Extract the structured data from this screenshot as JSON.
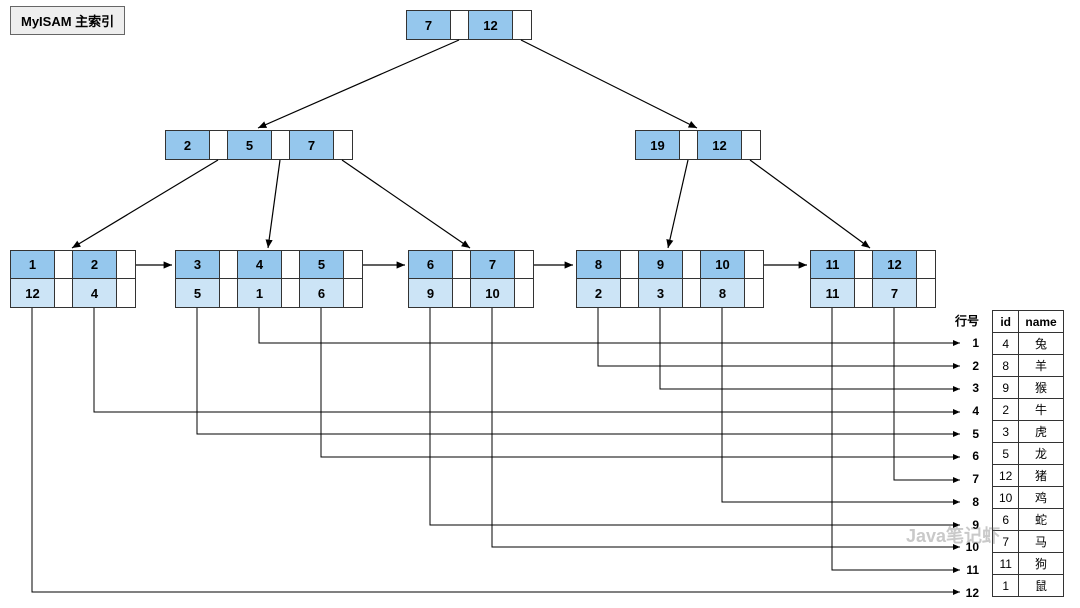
{
  "title": "MyISAM 主索引",
  "root": {
    "keys": [
      "7",
      "12"
    ]
  },
  "internal_left": {
    "keys": [
      "2",
      "5",
      "7"
    ]
  },
  "internal_right": {
    "keys": [
      "19",
      "12"
    ]
  },
  "leaf1": {
    "keys": [
      "1",
      "2"
    ],
    "ptrs": [
      "12",
      "4"
    ]
  },
  "leaf2": {
    "keys": [
      "3",
      "4",
      "5"
    ],
    "ptrs": [
      "5",
      "1",
      "6"
    ]
  },
  "leaf3": {
    "keys": [
      "6",
      "7"
    ],
    "ptrs": [
      "9",
      "10"
    ]
  },
  "leaf4": {
    "keys": [
      "8",
      "9",
      "10"
    ],
    "ptrs": [
      "2",
      "3",
      "8"
    ]
  },
  "leaf5": {
    "keys": [
      "11",
      "12"
    ],
    "ptrs": [
      "11",
      "7"
    ]
  },
  "row_header": "行号",
  "table_headers": {
    "id": "id",
    "name": "name"
  },
  "table_rows": [
    {
      "row": "1",
      "id": "4",
      "name": "兔"
    },
    {
      "row": "2",
      "id": "8",
      "name": "羊"
    },
    {
      "row": "3",
      "id": "9",
      "name": "猴"
    },
    {
      "row": "4",
      "id": "2",
      "name": "牛"
    },
    {
      "row": "5",
      "id": "3",
      "name": "虎"
    },
    {
      "row": "6",
      "id": "5",
      "name": "龙"
    },
    {
      "row": "7",
      "id": "12",
      "name": "猪"
    },
    {
      "row": "8",
      "id": "10",
      "name": "鸡"
    },
    {
      "row": "9",
      "id": "6",
      "name": "蛇"
    },
    {
      "row": "10",
      "id": "7",
      "name": "马"
    },
    {
      "row": "11",
      "id": "11",
      "name": "狗"
    },
    {
      "row": "12",
      "id": "1",
      "name": "鼠"
    }
  ],
  "watermark": "Java笔记虾"
}
